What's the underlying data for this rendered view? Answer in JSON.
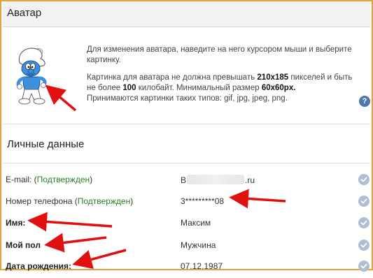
{
  "avatar_section": {
    "title": "Аватар",
    "hint": "Для изменения аватара, наведите на него курсором мыши и выберите картинку.",
    "limit_pre": "Картинка для аватара не должна превышать ",
    "limit_size": "210x185",
    "limit_mid1": " пикселей и быть не более ",
    "limit_kb": "100",
    "limit_mid2": " килобайт. Минимальный размер ",
    "limit_min": "60x60px.",
    "types": "Принимаются картинки таких типов: gif, jpg, jpeg, png.",
    "help_label": "?"
  },
  "personal_section": {
    "title": "Личные данные",
    "email": {
      "label": "E-mail: (",
      "status": "Подтвержден",
      "label_end": ")",
      "value_start": "B",
      "value_end": ".ru"
    },
    "phone": {
      "label": "Номер телефона (",
      "status": "Подтвержден",
      "label_end": ")",
      "value": "3*********08"
    },
    "name": {
      "label": "Имя:",
      "value": "Максим"
    },
    "gender": {
      "label": "Мой пол",
      "value": "Мужчина"
    },
    "birthday": {
      "label": "Дата рождения:",
      "value": "07.12.1987"
    }
  },
  "colors": {
    "border": "#e4a23a",
    "header_bg": "#f2f2f2",
    "confirmed": "#2a7d2a",
    "arrow": "#e01010",
    "check": "#aebfd1",
    "help": "#4a7ab0"
  },
  "icons": {
    "avatar": "smurf-image",
    "help": "question-circle-icon",
    "check": "check-circle-icon",
    "annotation": "red-arrow"
  }
}
